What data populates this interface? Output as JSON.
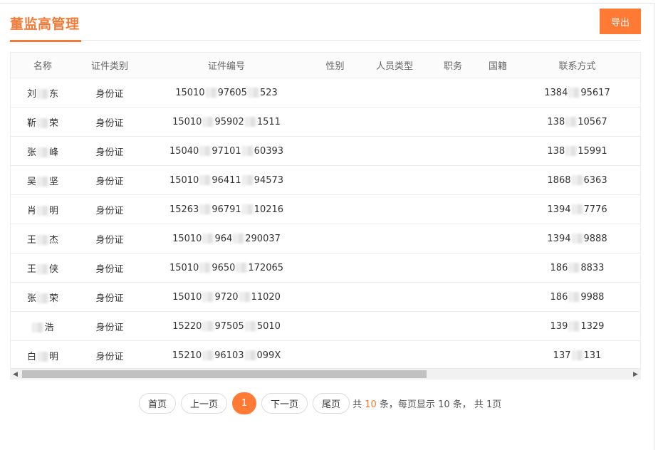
{
  "page": {
    "title": "董监高管理",
    "export_label": "导出"
  },
  "table": {
    "columns": [
      "名称",
      "证件类别",
      "证件编号",
      "性别",
      "人员类型",
      "职务",
      "国籍",
      "联系方式"
    ],
    "rows": [
      {
        "name_a": "刘",
        "name_b": "东",
        "id_type": "身份证",
        "id_a": "15010",
        "id_b": "97605",
        "id_c": "523",
        "gender": "",
        "person_type": "",
        "position": "",
        "nationality": "",
        "contact_a": "1384",
        "contact_b": "95617"
      },
      {
        "name_a": "靳",
        "name_b": "荣",
        "id_type": "身份证",
        "id_a": "15010",
        "id_b": "95902",
        "id_c": "1511",
        "gender": "",
        "person_type": "",
        "position": "",
        "nationality": "",
        "contact_a": "138",
        "contact_b": "10567"
      },
      {
        "name_a": "张",
        "name_b": "峰",
        "id_type": "身份证",
        "id_a": "15040",
        "id_b": "97101",
        "id_c": "60393",
        "gender": "",
        "person_type": "",
        "position": "",
        "nationality": "",
        "contact_a": "138",
        "contact_b": "15991"
      },
      {
        "name_a": "吴",
        "name_b": "坚",
        "id_type": "身份证",
        "id_a": "15010",
        "id_b": "96411",
        "id_c": "94573",
        "gender": "",
        "person_type": "",
        "position": "",
        "nationality": "",
        "contact_a": "1868",
        "contact_b": "6363"
      },
      {
        "name_a": "肖",
        "name_b": "明",
        "id_type": "身份证",
        "id_a": "15263",
        "id_b": "96791",
        "id_c": "10216",
        "gender": "",
        "person_type": "",
        "position": "",
        "nationality": "",
        "contact_a": "1394",
        "contact_b": "7776"
      },
      {
        "name_a": "王",
        "name_b": "杰",
        "id_type": "身份证",
        "id_a": "15010",
        "id_b": "964",
        "id_c": "290037",
        "gender": "",
        "person_type": "",
        "position": "",
        "nationality": "",
        "contact_a": "1394",
        "contact_b": "9888"
      },
      {
        "name_a": "王",
        "name_b": "侠",
        "id_type": "身份证",
        "id_a": "15010",
        "id_b": "9650",
        "id_c": "172065",
        "gender": "",
        "person_type": "",
        "position": "",
        "nationality": "",
        "contact_a": "186",
        "contact_b": "8833"
      },
      {
        "name_a": "张",
        "name_b": "荣",
        "id_type": "身份证",
        "id_a": "15010",
        "id_b": "9720",
        "id_c": "11020",
        "gender": "",
        "person_type": "",
        "position": "",
        "nationality": "",
        "contact_a": "186",
        "contact_b": "9988"
      },
      {
        "name_a": "",
        "name_b": "浩",
        "id_type": "身份证",
        "id_a": "15220",
        "id_b": "97505",
        "id_c": "5010",
        "gender": "",
        "person_type": "",
        "position": "",
        "nationality": "",
        "contact_a": "139",
        "contact_b": "1329"
      },
      {
        "name_a": "白",
        "name_b": "明",
        "id_type": "身份证",
        "id_a": "15210",
        "id_b": "96103",
        "id_c": "099X",
        "gender": "",
        "person_type": "",
        "position": "",
        "nationality": "",
        "contact_a": "137",
        "contact_b": "131"
      }
    ]
  },
  "pagination": {
    "first": "首页",
    "prev": "上一页",
    "current": "1",
    "next": "下一页",
    "last": "尾页",
    "info_prefix": "共",
    "total": "10",
    "info_mid": "条，每页显示",
    "per_page": "10",
    "info_suffix": "条， 共 1页"
  },
  "colors": {
    "accent": "#ff7a35",
    "title": "#f47a37"
  }
}
